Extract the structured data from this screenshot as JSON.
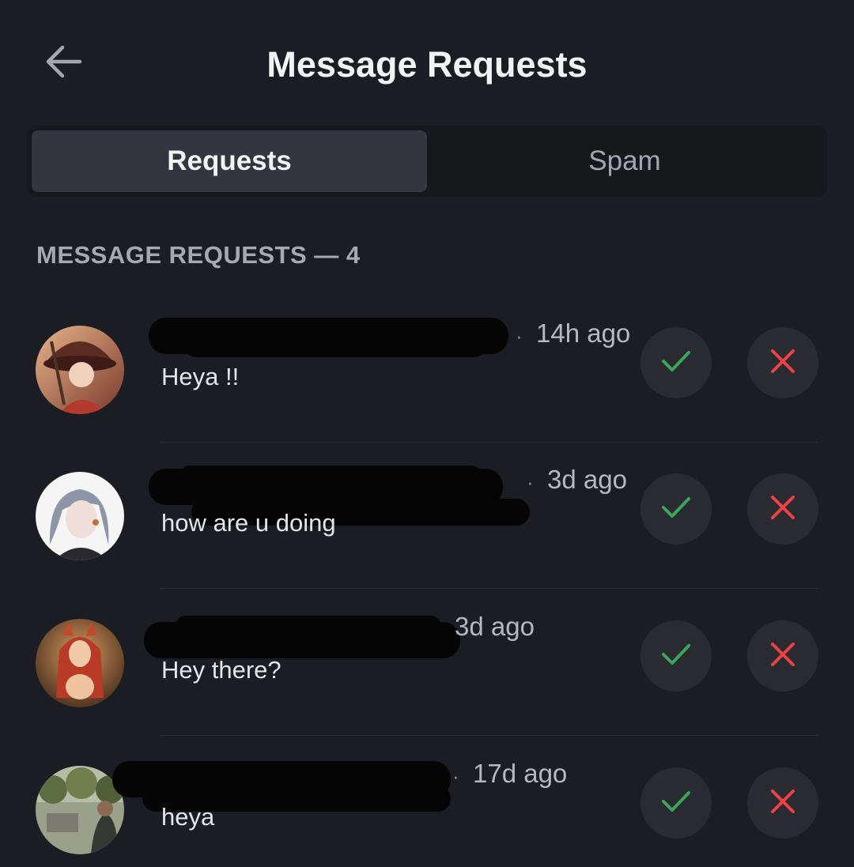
{
  "header": {
    "title": "Message Requests",
    "back_icon": "arrow-left-icon"
  },
  "tabs": [
    {
      "label": "Requests",
      "active": true
    },
    {
      "label": "Spam",
      "active": false
    }
  ],
  "section": {
    "label": "MESSAGE REQUESTS — 4"
  },
  "requests": [
    {
      "time": "14h ago",
      "message": "Heya !!",
      "avatar_icon": "avatar-witch-hat"
    },
    {
      "time": "3d ago",
      "message": "how are u doing",
      "avatar_icon": "avatar-grey-hair"
    },
    {
      "time": "3d ago",
      "message": "Hey there?",
      "avatar_icon": "avatar-fox-girl"
    },
    {
      "time": "17d ago",
      "message": "heya",
      "avatar_icon": "avatar-outdoor-photo"
    }
  ],
  "colors": {
    "background": "#1c1d22",
    "accept": "#3ba55c",
    "decline": "#ed4245"
  }
}
